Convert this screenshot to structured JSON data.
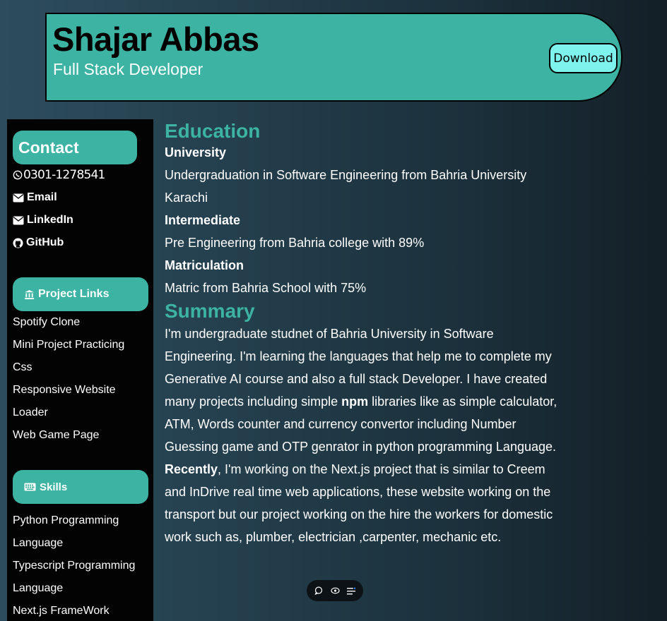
{
  "header": {
    "name": "Shajar Abbas",
    "role": "Full Stack Developer",
    "download_label": "Download"
  },
  "sidebar": {
    "contact": {
      "title": "Contact",
      "phone": "0301-1278541",
      "email_label": "Email",
      "linkedin_label": "LinkedIn",
      "github_label": "GitHub"
    },
    "projects": {
      "title": "Project Links",
      "items": [
        "Spotify Clone",
        "Mini Project Practicing",
        "Css",
        "Responsive Website",
        "Loader",
        "Web Game Page"
      ]
    },
    "skills": {
      "title": "Skills",
      "items": [
        "Python Programming",
        "Language",
        "Typescript Programming",
        "Language",
        "Next.js FrameWork"
      ]
    }
  },
  "education": {
    "title": "Education",
    "university_label": "University",
    "university_text_1": "Undergraduation in Software Engineering from Bahria University",
    "university_text_2": "Karachi",
    "intermediate_label": "Intermediate",
    "intermediate_text": "Pre Engineering from Bahria college with 89%",
    "matric_label": "Matriculation",
    "matric_text": "Matric from Bahria School with 75%"
  },
  "summary": {
    "title": "Summary",
    "p1_before": "I'm undergraduate studnet of Bahria University in Software Engineering. I'm learning the languages that help me to complete my Generative AI course and also a full stack Developer. I have created many projects including simple ",
    "p1_bold": "npm",
    "p1_after": " libraries like as simple calculator, ATM, Words counter and currency convertor including Number Guessing game and OTP genrator in python programming Language.",
    "p2_bold": "Recently",
    "p2_after": ", I'm working on the Next.js project that is similar to Creem and InDrive real time web applications, these website working on the transport but our project working on the hire the workers for domestic work such as, plumber, electrician ,carpenter, mechanic etc."
  },
  "icons": {
    "phone": "whatsapp-icon",
    "email": "envelope-icon",
    "linkedin": "envelope-icon",
    "github": "github-icon",
    "projects": "bank-icon",
    "skills": "keyboard-icon"
  },
  "colors": {
    "accent": "#3cb3a3",
    "download_bg": "#7ef3ee",
    "sidebar_bg": "#030303"
  }
}
